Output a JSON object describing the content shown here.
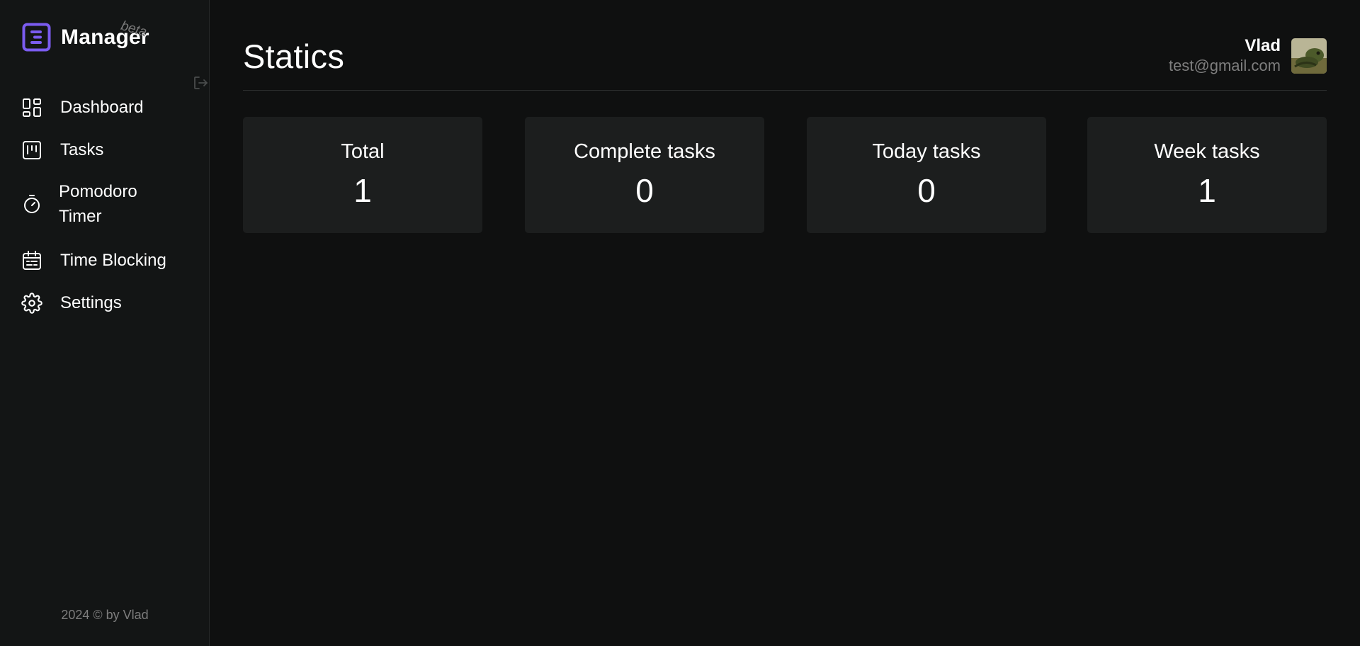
{
  "brand": {
    "name": "Manager",
    "badge": "beta",
    "accent_color": "#7b5cf0"
  },
  "sidebar": {
    "items": [
      {
        "label": "Dashboard",
        "icon": "dashboard-icon"
      },
      {
        "label": "Tasks",
        "icon": "kanban-icon"
      },
      {
        "label": "Pomodoro Timer",
        "icon": "timer-icon"
      },
      {
        "label": "Time Blocking",
        "icon": "calendar-icon"
      },
      {
        "label": "Settings",
        "icon": "gear-icon"
      }
    ],
    "collapse_icon": "logout-icon"
  },
  "footer": {
    "text": "2024 © by Vlad"
  },
  "header": {
    "title": "Statics"
  },
  "user": {
    "name": "Vlad",
    "email": "test@gmail.com"
  },
  "stats": [
    {
      "label": "Total",
      "value": "1"
    },
    {
      "label": "Complete tasks",
      "value": "0"
    },
    {
      "label": "Today tasks",
      "value": "0"
    },
    {
      "label": "Week tasks",
      "value": "1"
    }
  ]
}
